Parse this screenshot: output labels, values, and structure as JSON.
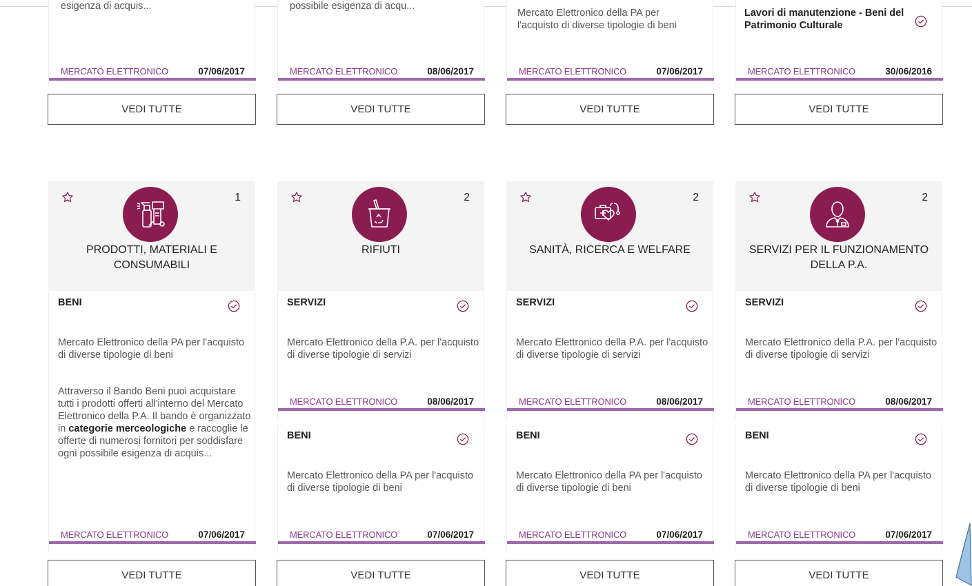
{
  "top_row": [
    {
      "excerpt": "esigenza di acquis...",
      "source": "MERCATO ELETTRONICO",
      "date": "07/06/2017",
      "button": "VEDI TUTTE"
    },
    {
      "excerpt": "possibile esigenza di acqu...",
      "source": "MERCATO ELETTRONICO",
      "date": "08/06/2017",
      "button": "VEDI TUTTE"
    },
    {
      "excerpt": "Mercato Elettronico della PA per l'acquisto di diverse tipologie di beni",
      "source": "MERCATO ELETTRONICO",
      "date": "07/06/2017",
      "button": "VEDI TUTTE"
    },
    {
      "title": "Lavori di manutenzione - Beni del Patrimonio Culturale",
      "source": "MERCATO ELETTRONICO",
      "date": "30/06/2016",
      "button": "VEDI TUTTE"
    }
  ],
  "categories": [
    {
      "name": "PRODOTTI, MATERIALI E CONSUMABILI",
      "count": "1",
      "icon": "cleaning-products-icon",
      "items": [
        {
          "type": "BENI",
          "desc": "Mercato Elettronico della PA per l'acquisto di diverse tipologie di beni",
          "long_a": "Attraverso il Bando Beni puoi acquistare tutti i prodotti offerti all'interno del Mercato Elettronico della P.A. Il bando è organizzato in ",
          "long_b": "categorie merceologiche",
          "long_c": " e raccoglie le offerte di numerosi fornitori per soddisfare ogni possibile esigenza di acquis...",
          "source": "MERCATO ELETTRONICO",
          "date": "07/06/2017"
        }
      ],
      "button": "VEDI TUTTE"
    },
    {
      "name": "RIFIUTI",
      "count": "2",
      "icon": "recycle-bin-icon",
      "items": [
        {
          "type": "SERVIZI",
          "desc": "Mercato Elettronico della P.A. per l'acquisto di diverse tipologie di servizi",
          "source": "MERCATO ELETTRONICO",
          "date": "08/06/2017"
        },
        {
          "type": "BENI",
          "desc": "Mercato Elettronico della PA per l'acquisto di diverse tipologie di beni",
          "source": "MERCATO ELETTRONICO",
          "date": "07/06/2017"
        }
      ],
      "button": "VEDI TUTTE"
    },
    {
      "name": "SANITÀ, RICERCA E WELFARE",
      "count": "2",
      "icon": "health-care-icon",
      "items": [
        {
          "type": "SERVIZI",
          "desc": "Mercato Elettronico della P.A. per l'acquisto di diverse tipologie di servizi",
          "source": "MERCATO ELETTRONICO",
          "date": "08/06/2017"
        },
        {
          "type": "BENI",
          "desc": "Mercato Elettronico della PA per l'acquisto di diverse tipologie di beni",
          "source": "MERCATO ELETTRONICO",
          "date": "07/06/2017"
        }
      ],
      "button": "VEDI TUTTE"
    },
    {
      "name": "SERVIZI PER IL FUNZIONAMENTO DELLA P.A.",
      "count": "2",
      "icon": "employee-icon",
      "items": [
        {
          "type": "SERVIZI",
          "desc": "Mercato Elettronico della P.A. per l'acquisto di diverse tipologie di servizi",
          "source": "MERCATO ELETTRONICO",
          "date": "08/06/2017"
        },
        {
          "type": "BENI",
          "desc": "Mercato Elettronico della PA per l'acquisto di diverse tipologie di beni",
          "source": "MERCATO ELETTRONICO",
          "date": "07/06/2017"
        }
      ],
      "button": "VEDI TUTTE"
    }
  ],
  "colors": {
    "accent": "#8a1c50",
    "source_text": "#8a3a8a",
    "rule": "#9c6aa8",
    "header_bg": "#f4f4f4",
    "arrow_fill": "#9dc3e6"
  },
  "icons": {
    "favorite": "star-outline-icon",
    "active": "check-circle-icon",
    "cursor": "scroll-arrow-icon"
  }
}
